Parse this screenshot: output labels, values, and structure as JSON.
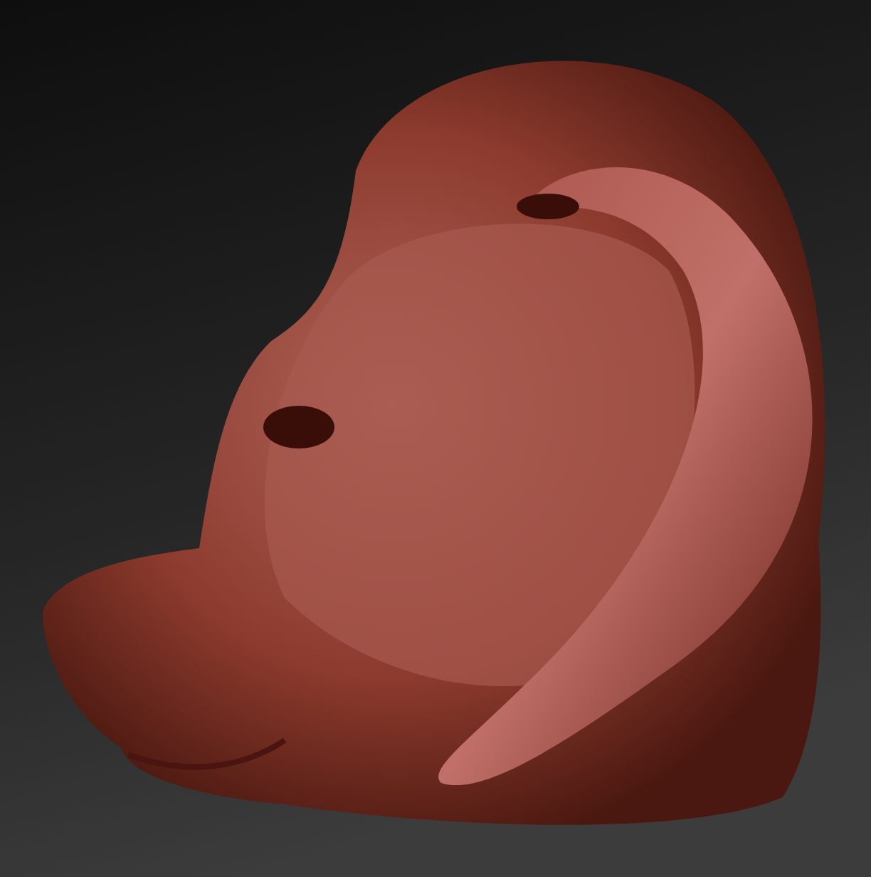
{
  "viewport": {
    "kind": "sculpt"
  }
}
